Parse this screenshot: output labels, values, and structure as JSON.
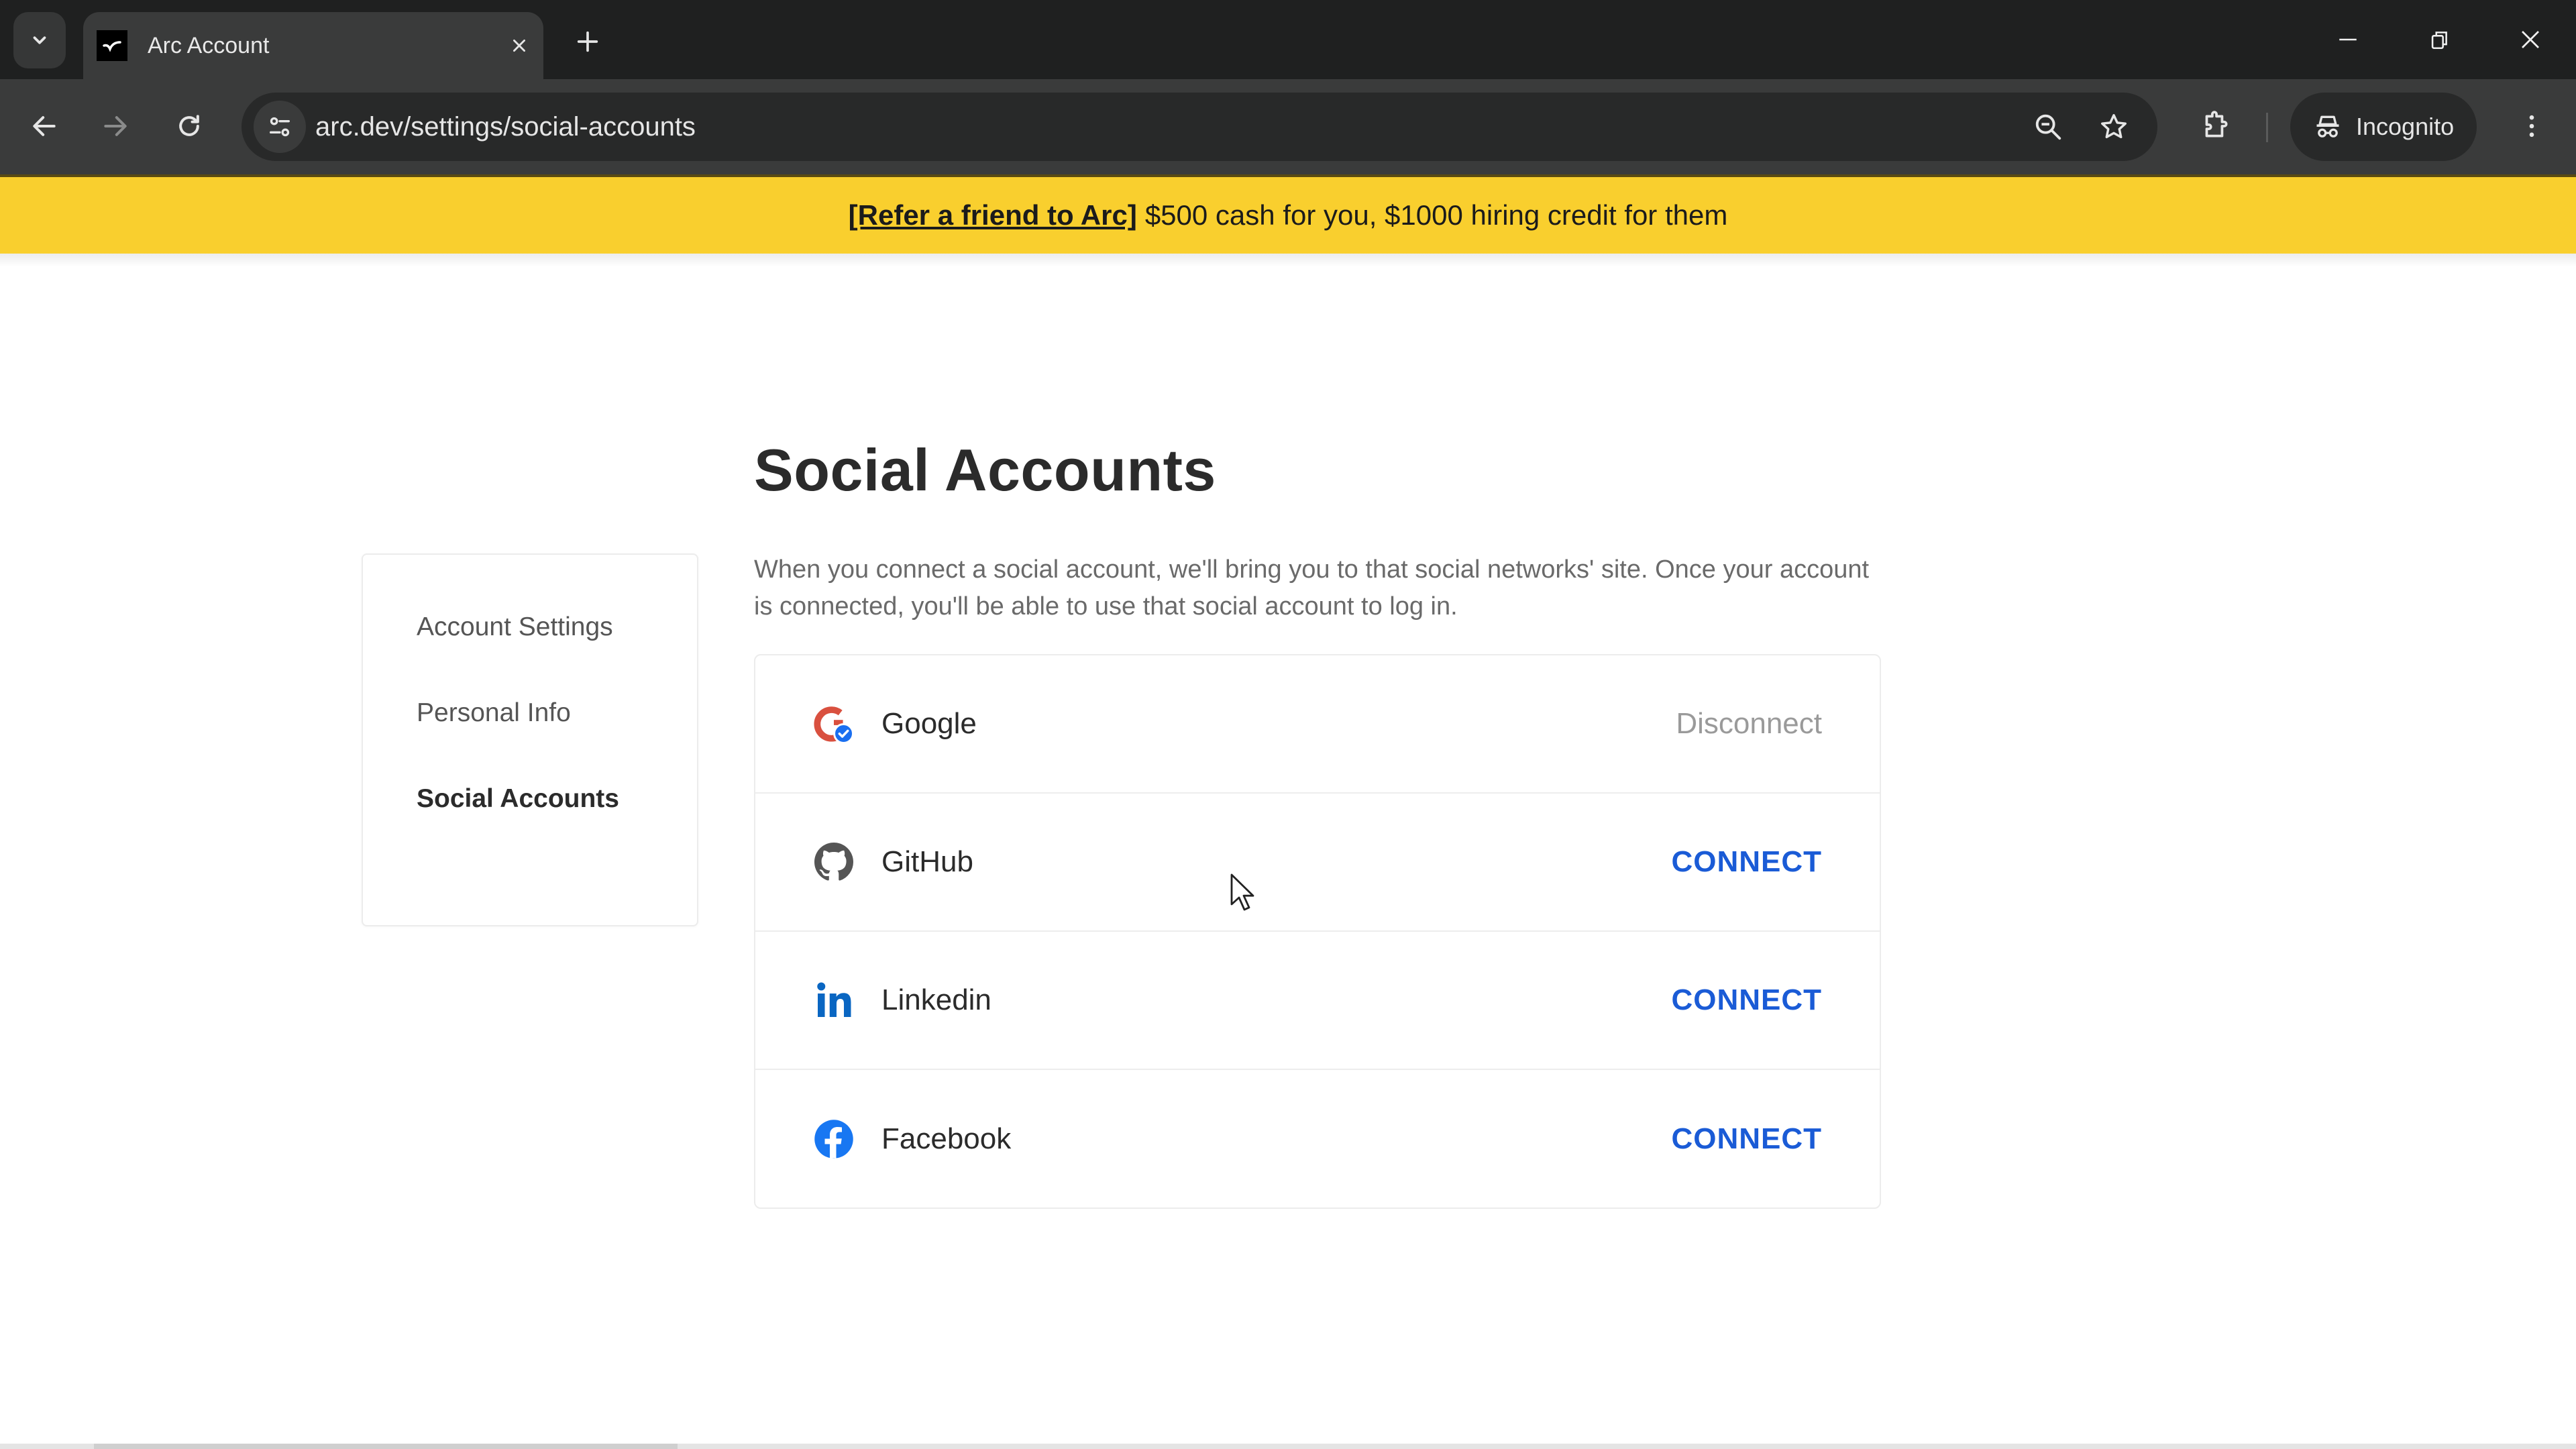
{
  "browser": {
    "tab_title": "Arc Account",
    "url": "arc.dev/settings/social-accounts",
    "profile_label": "Incognito",
    "icons": {
      "tab_search": "chevron-down-icon",
      "favicon": "arc-logo-icon",
      "tab_close": "close-icon",
      "new_tab": "plus-icon",
      "minimize": "minimize-icon",
      "restore": "restore-icon",
      "window_close": "close-icon",
      "back": "arrow-left-icon",
      "forward": "arrow-right-icon",
      "reload": "reload-icon",
      "site_info": "tune-icon",
      "zoom": "zoom-out-icon",
      "bookmark": "star-icon",
      "extensions": "puzzle-icon",
      "incognito": "incognito-icon",
      "menu": "more-vertical-icon"
    }
  },
  "banner": {
    "link_text": "[Refer a friend to Arc]",
    "message": "$500 cash for you, $1000 hiring credit for them",
    "color": "#f9cf2e"
  },
  "page": {
    "title": "Social Accounts",
    "description": "When you connect a social account, we'll bring you to that social networks' site. Once your account is connected, you'll be able to use that social account to log in."
  },
  "sidebar": {
    "items": [
      {
        "label": "Account Settings",
        "active": false
      },
      {
        "label": "Personal Info",
        "active": false
      },
      {
        "label": "Social Accounts",
        "active": true
      }
    ]
  },
  "accounts": [
    {
      "name": "Google",
      "icon": "google-icon",
      "connected": true,
      "action": "Disconnect"
    },
    {
      "name": "GitHub",
      "icon": "github-icon",
      "connected": false,
      "action": "CONNECT"
    },
    {
      "name": "Linkedin",
      "icon": "linkedin-icon",
      "connected": false,
      "action": "CONNECT"
    },
    {
      "name": "Facebook",
      "icon": "facebook-icon",
      "connected": false,
      "action": "CONNECT"
    }
  ],
  "colors": {
    "connect": "#1a5bd6",
    "disconnect": "#9a9a9a",
    "google_red": "#d9503f",
    "verified_blue": "#1a6ff0",
    "linkedin_blue": "#0a66c2",
    "facebook_blue": "#1877f2",
    "github_gray": "#555555"
  }
}
